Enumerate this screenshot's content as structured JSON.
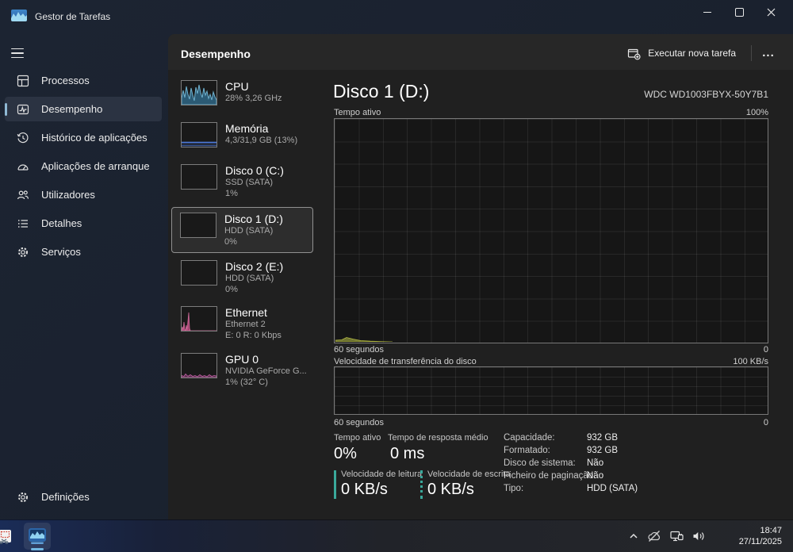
{
  "colors": {
    "accent_selection": "#8fb9d4",
    "disk_speed_teal": "#3aa99b",
    "cpu_graph_blue": "#6fb1ce",
    "memory_graph_blue": "#4e7ce0",
    "ethernet_graph_pink": "#d06a9a",
    "gpu_graph_pink": "#c45fa8",
    "disk_activity_yellow": "#b4ba45",
    "taskbar_indicator_blue": "#71b7e2"
  },
  "titlebar": {
    "title": "Gestor de Tarefas"
  },
  "sidebar": {
    "items": [
      {
        "label": "Processos",
        "icon": "processes-icon"
      },
      {
        "label": "Desempenho",
        "icon": "performance-icon",
        "selected": true
      },
      {
        "label": "Histórico de aplicações",
        "icon": "history-icon"
      },
      {
        "label": "Aplicações de arranque",
        "icon": "startup-icon"
      },
      {
        "label": "Utilizadores",
        "icon": "users-icon"
      },
      {
        "label": "Detalhes",
        "icon": "details-icon"
      },
      {
        "label": "Serviços",
        "icon": "services-icon"
      }
    ],
    "settings_label": "Definições"
  },
  "header": {
    "title": "Desempenho",
    "new_task_label": "Executar nova tarefa",
    "more_label": "..."
  },
  "perf": [
    {
      "name": "CPU",
      "sub1": "28% 3,26 GHz"
    },
    {
      "name": "Memória",
      "sub1": "4,3/31,9 GB (13%)"
    },
    {
      "name": "Disco 0 (C:)",
      "sub1": "SSD (SATA)",
      "sub2": "1%"
    },
    {
      "name": "Disco 1 (D:)",
      "sub1": "HDD (SATA)",
      "sub2": "0%",
      "selected": true
    },
    {
      "name": "Disco 2 (E:)",
      "sub1": "HDD (SATA)",
      "sub2": "0%"
    },
    {
      "name": "Ethernet",
      "sub1": "Ethernet 2",
      "sub2": "E: 0 R: 0 Kbps"
    },
    {
      "name": "GPU 0",
      "sub1": "NVIDIA GeForce G...",
      "sub2": "1% (32° C)"
    }
  ],
  "detail": {
    "title": "Disco 1 (D:)",
    "model": "WDC WD1003FBYX-50Y7B1",
    "chart1": {
      "label": "Tempo ativo",
      "max": "100%",
      "xlabel": "60 segundos",
      "min": "0"
    },
    "chart2": {
      "label": "Velocidade de transferência do disco",
      "max": "100 KB/s",
      "xlabel": "60 segundos",
      "min": "0"
    },
    "stats": {
      "active_time": {
        "label": "Tempo ativo",
        "value": "0%"
      },
      "response_time": {
        "label": "Tempo de resposta médio",
        "value": "0 ms"
      },
      "read_speed": {
        "label": "Velocidade de leitura",
        "value": "0 KB/s"
      },
      "write_speed": {
        "label": "Velocidade de escrita",
        "value": "0 KB/s"
      }
    },
    "props": [
      {
        "label": "Capacidade:",
        "value": "932 GB"
      },
      {
        "label": "Formatado:",
        "value": "932 GB"
      },
      {
        "label": "Disco de sistema:",
        "value": "Não"
      },
      {
        "label": "Ficheiro de paginação:",
        "value": "Não"
      },
      {
        "label": "Tipo:",
        "value": "HDD (SATA)"
      }
    ]
  },
  "taskbar": {
    "time": "18:47",
    "date": "27/11/2025"
  }
}
